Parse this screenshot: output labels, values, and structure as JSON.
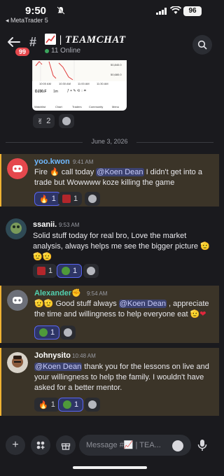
{
  "status_bar": {
    "time": "9:50",
    "back_app": "◂ MetaTrader 5",
    "battery": "96"
  },
  "header": {
    "badge": "99",
    "channel_label": "| TEAMCHAT",
    "online": "11 Online"
  },
  "embed": {
    "symbol": "DJ30.F",
    "timeframe": "1m",
    "axis_times": [
      "10:00 AM",
      "10:30 AM",
      "11:00 AM",
      "11:30 AM"
    ],
    "prices": [
      "50,840.0",
      "50,680.0"
    ],
    "nav": [
      "Watchlist",
      "Chart",
      "Traders",
      "Community",
      "Menu"
    ]
  },
  "top_reactions": {
    "peace_count": "2"
  },
  "divider": {
    "date": "June 3, 2026"
  },
  "messages": [
    {
      "user": "yoo.kwon",
      "time": "9:41 AM",
      "text_a": "Fire ",
      "text_b": " call today ",
      "mention": "@Koen Dean",
      "text_c": " I didn't get into a trade but Wowwww koze killing the game",
      "r1": "1",
      "r2": "1"
    },
    {
      "user": "ssanii.",
      "time": "9:53 AM",
      "text": "Solid stuff today for real bro, Love the market analysis, always helps me see the bigger picture",
      "r1": "1",
      "r2": "1"
    },
    {
      "user": "Alexander",
      "time": "9:54 AM",
      "text_a": " Good stuff always ",
      "mention": "@Koen Dean",
      "text_b": " , appreciate the time and willingness to help everyone eat",
      "r1": "1"
    },
    {
      "user": "Johnysito",
      "time": "10:48 AM",
      "mention": "@Koen Dean",
      "text": " thank you for the lessons on live and your willingness to help the family. I wouldn't have asked for a better mentor.",
      "r1": "1",
      "r2": "1"
    }
  ],
  "composer": {
    "placeholder": "Message #📈 | TEA..."
  },
  "colors": {
    "accent": "#5865f2",
    "highlight": "#f0b232",
    "online": "#3ba55d"
  }
}
